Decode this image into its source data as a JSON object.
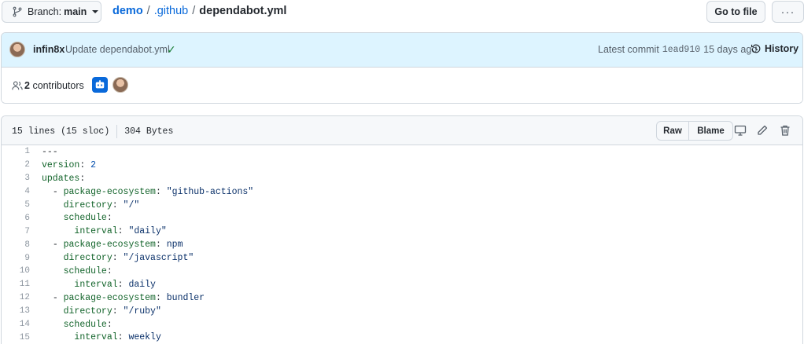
{
  "topbar": {
    "branch_prefix": "Branch:",
    "branch_name": "main",
    "breadcrumb": {
      "repo": "demo",
      "sep1": "/",
      "folder": ".github",
      "sep2": "/",
      "file": "dependabot.yml"
    },
    "goto_file_label": "Go to file",
    "more_label": "···"
  },
  "commit": {
    "author": "infin8x",
    "message": "Update dependabot.yml",
    "latest_label": "Latest commit",
    "sha": "1ead910",
    "age": "15 days ago",
    "history_label": "History"
  },
  "contributors": {
    "count": "2",
    "label": "contributors"
  },
  "file": {
    "lines_info": "15 lines (15 sloc)",
    "size": "304 Bytes",
    "raw_label": "Raw",
    "blame_label": "Blame"
  },
  "code_lines": [
    {
      "n": "1",
      "indent": "",
      "dash": "",
      "key": "",
      "colon": "",
      "val": "",
      "raw": "---",
      "vt": ""
    },
    {
      "n": "2",
      "indent": "",
      "dash": "",
      "key": "version",
      "colon": ": ",
      "val": "2",
      "raw": "",
      "vt": "n"
    },
    {
      "n": "3",
      "indent": "",
      "dash": "",
      "key": "updates",
      "colon": ":",
      "val": "",
      "raw": "",
      "vt": ""
    },
    {
      "n": "4",
      "indent": "  ",
      "dash": "- ",
      "key": "package-ecosystem",
      "colon": ": ",
      "val": "\"github-actions\"",
      "raw": "",
      "vt": "s"
    },
    {
      "n": "5",
      "indent": "    ",
      "dash": "",
      "key": "directory",
      "colon": ": ",
      "val": "\"/\"",
      "raw": "",
      "vt": "s"
    },
    {
      "n": "6",
      "indent": "    ",
      "dash": "",
      "key": "schedule",
      "colon": ":",
      "val": "",
      "raw": "",
      "vt": ""
    },
    {
      "n": "7",
      "indent": "      ",
      "dash": "",
      "key": "interval",
      "colon": ": ",
      "val": "\"daily\"",
      "raw": "",
      "vt": "s"
    },
    {
      "n": "8",
      "indent": "  ",
      "dash": "- ",
      "key": "package-ecosystem",
      "colon": ": ",
      "val": "npm",
      "raw": "",
      "vt": "s"
    },
    {
      "n": "9",
      "indent": "    ",
      "dash": "",
      "key": "directory",
      "colon": ": ",
      "val": "\"/javascript\"",
      "raw": "",
      "vt": "s"
    },
    {
      "n": "10",
      "indent": "    ",
      "dash": "",
      "key": "schedule",
      "colon": ":",
      "val": "",
      "raw": "",
      "vt": ""
    },
    {
      "n": "11",
      "indent": "      ",
      "dash": "",
      "key": "interval",
      "colon": ": ",
      "val": "daily",
      "raw": "",
      "vt": "s"
    },
    {
      "n": "12",
      "indent": "  ",
      "dash": "- ",
      "key": "package-ecosystem",
      "colon": ": ",
      "val": "bundler",
      "raw": "",
      "vt": "s"
    },
    {
      "n": "13",
      "indent": "    ",
      "dash": "",
      "key": "directory",
      "colon": ": ",
      "val": "\"/ruby\"",
      "raw": "",
      "vt": "s"
    },
    {
      "n": "14",
      "indent": "    ",
      "dash": "",
      "key": "schedule",
      "colon": ":",
      "val": "",
      "raw": "",
      "vt": ""
    },
    {
      "n": "15",
      "indent": "      ",
      "dash": "",
      "key": "interval",
      "colon": ": ",
      "val": "weekly",
      "raw": "",
      "vt": "s"
    }
  ]
}
